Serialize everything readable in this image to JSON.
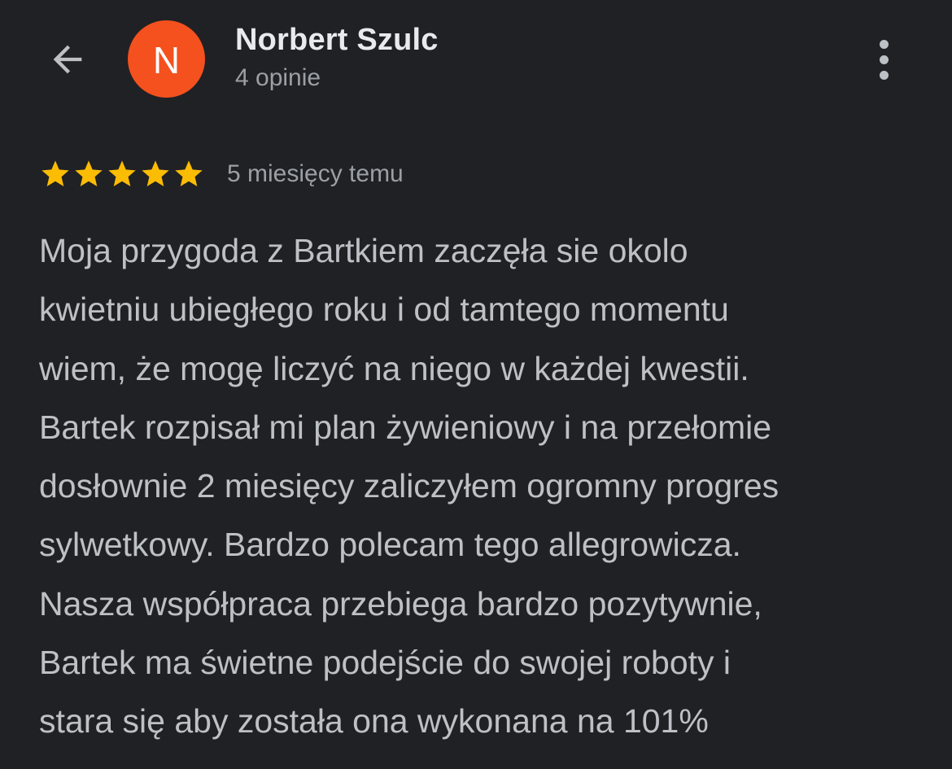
{
  "header": {
    "back_icon": "arrow-back-icon",
    "avatar_letter": "N",
    "avatar_color": "#f4511e",
    "reviewer_name": "Norbert Szulc",
    "review_count": "4 opinie",
    "more_icon": "more-vert-icon"
  },
  "review": {
    "rating": 5,
    "rating_max": 5,
    "star_color": "#fbbc04",
    "date": "5 miesięcy temu",
    "lines": [
      "Moja przygoda z Bartkiem zaczęła sie okolo",
      "kwietniu ubiegłego roku i od tamtego momentu",
      "wiem, że mogę liczyć na niego w każdej kwestii.",
      "Bartek rozpisał mi plan żywieniowy i na przełomie",
      "dosłownie 2 miesięcy zaliczyłem ogromny progres",
      "sylwetkowy. Bardzo polecam tego allegrowicza.",
      "Nasza współpraca przebiega bardzo pozytywnie,",
      "Bartek ma świetne podejście do swojej roboty i",
      "stara się aby została ona wykonana na 101%"
    ]
  }
}
